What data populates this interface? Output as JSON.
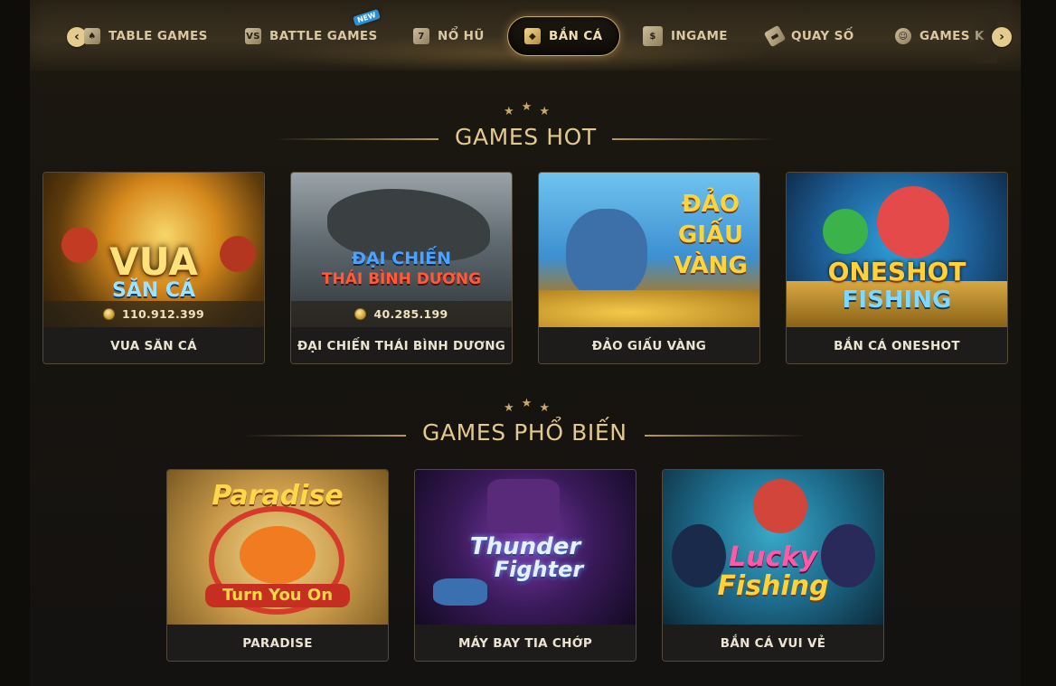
{
  "nav": {
    "tabs": [
      {
        "label": "TABLE GAMES",
        "icon": "cards-icon"
      },
      {
        "label": "BATTLE GAMES",
        "icon": "versus-icon",
        "badge": "NEW"
      },
      {
        "label": "NỔ HŨ",
        "icon": "slot-icon"
      },
      {
        "label": "BẮN CÁ",
        "icon": "fish-icon",
        "active": true
      },
      {
        "label": "INGAME",
        "icon": "ingame-cards-icon"
      },
      {
        "label": "QUAY SỐ",
        "icon": "lottery-ticket-icon"
      },
      {
        "label": "GAMES K",
        "icon": "smile-icon"
      }
    ],
    "prev_arrow": "‹",
    "next_arrow": "›"
  },
  "sections": {
    "hot": {
      "title": "GAMES HOT",
      "cards": [
        {
          "name": "VUA SĂN CÁ",
          "jackpot": "110.912.399",
          "art_text": [
            "VUA",
            "SĂN CÁ"
          ]
        },
        {
          "name": "ĐẠI CHIẾN THÁI BÌNH DƯƠNG",
          "jackpot": "40.285.199",
          "art_text": [
            "ĐẠI CHIẾN",
            "THÁI BÌNH DƯƠNG"
          ]
        },
        {
          "name": "ĐẢO GIẤU VÀNG",
          "art_text": [
            "ĐẢO",
            "GIẤU",
            "VÀNG"
          ]
        },
        {
          "name": "BẮN CÁ ONESHOT",
          "art_text": [
            "ONESHOT",
            "FISHING"
          ]
        }
      ]
    },
    "popular": {
      "title": "GAMES PHỔ BIẾN",
      "cards": [
        {
          "name": "PARADISE",
          "art_text": [
            "Paradise",
            "Turn You On"
          ]
        },
        {
          "name": "MÁY BAY TIA CHỚP",
          "art_text": [
            "Thunder",
            "Fighter"
          ]
        },
        {
          "name": "BẮN CÁ VUI VẺ",
          "art_text": [
            "Lucky",
            "Fishing"
          ]
        }
      ]
    }
  },
  "colors": {
    "gold": "#e3c98d",
    "background": "#17140f",
    "card_label_bg": "#1e1c1b"
  }
}
